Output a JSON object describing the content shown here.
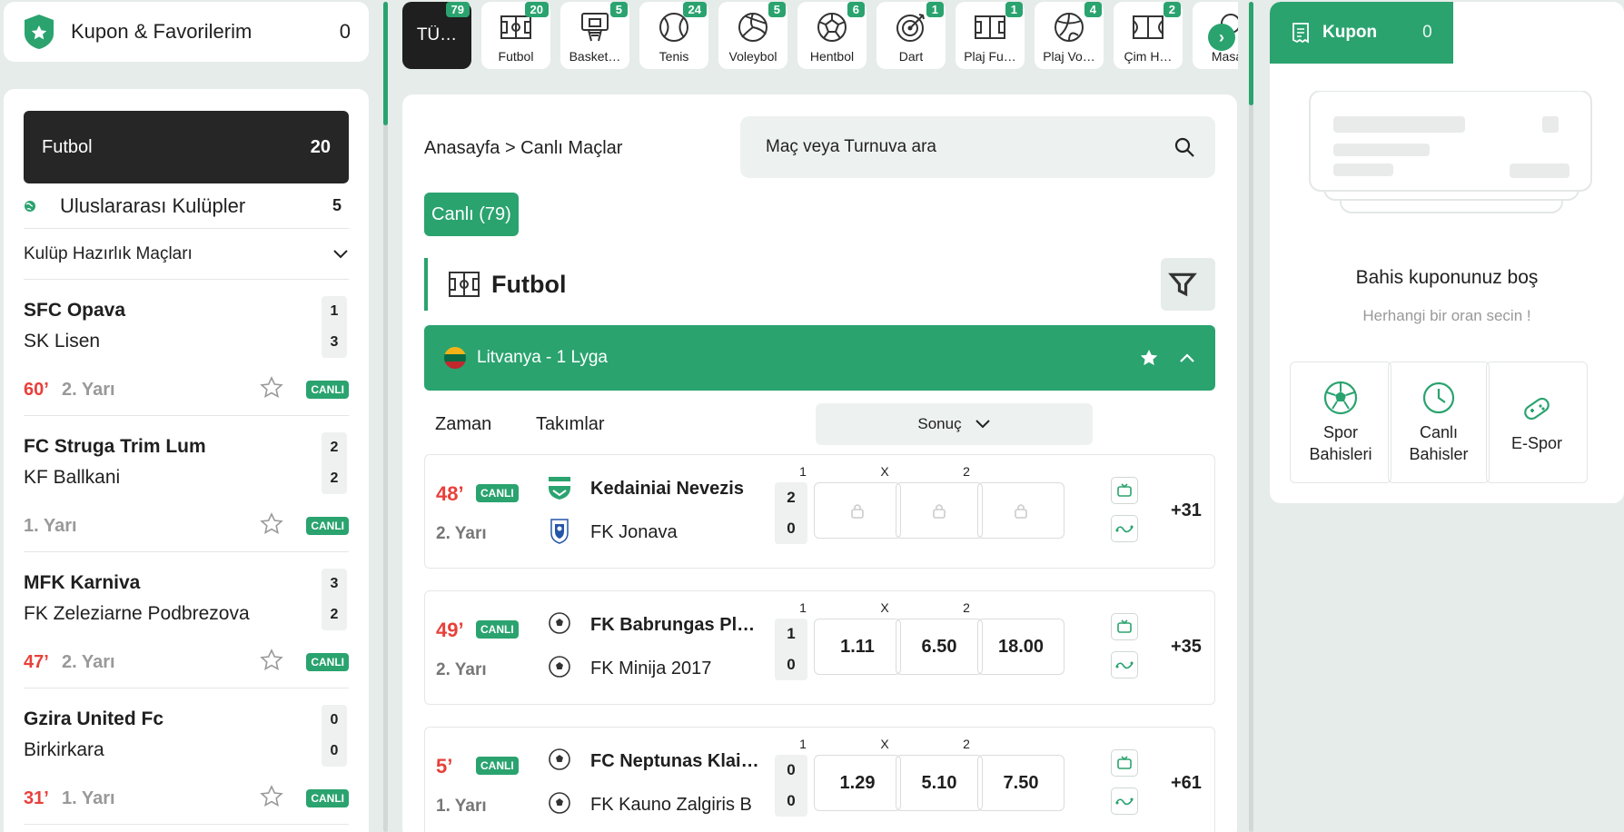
{
  "favorites": {
    "label": "Kupon & Favorilerim",
    "count": "0"
  },
  "left": {
    "sport": {
      "label": "Futbol",
      "count": "20"
    },
    "intl": {
      "label": "Uluslararası Kulüpler",
      "count": "5"
    },
    "category": {
      "label": "Kulüp Hazırlık Maçları"
    },
    "matches": [
      {
        "home": "SFC Opava",
        "away": "SK Lisen",
        "home_score": "1",
        "away_score": "3",
        "minute": "60’",
        "period": "2. Yarı",
        "badge": "CANLI"
      },
      {
        "home": "FC Struga Trim Lum",
        "away": "KF Ballkani",
        "home_score": "2",
        "away_score": "2",
        "minute": "",
        "period": "1. Yarı",
        "badge": "CANLI"
      },
      {
        "home": "MFK Karniva",
        "away": "FK Zeleziarne Podbrezova",
        "home_score": "3",
        "away_score": "2",
        "minute": "47’",
        "period": "2. Yarı",
        "badge": "CANLI"
      },
      {
        "home": "Gzira United Fc",
        "away": "Birkirkara",
        "home_score": "0",
        "away_score": "0",
        "minute": "31’",
        "period": "1. Yarı",
        "badge": "CANLI"
      }
    ]
  },
  "tabs": [
    {
      "label": "TÜ…",
      "count": "79",
      "icon": "all"
    },
    {
      "label": "Futbol",
      "count": "20",
      "icon": "football-field-icon"
    },
    {
      "label": "Basket…",
      "count": "5",
      "icon": "basketball-hoop-icon"
    },
    {
      "label": "Tenis",
      "count": "24",
      "icon": "tennis-ball-icon"
    },
    {
      "label": "Voleybol",
      "count": "5",
      "icon": "volleyball-icon"
    },
    {
      "label": "Hentbol",
      "count": "6",
      "icon": "handball-icon"
    },
    {
      "label": "Dart",
      "count": "1",
      "icon": "dart-target-icon"
    },
    {
      "label": "Plaj Fu…",
      "count": "1",
      "icon": "beach-football-icon"
    },
    {
      "label": "Plaj Vo…",
      "count": "4",
      "icon": "beach-volleyball-icon"
    },
    {
      "label": "Çim H…",
      "count": "2",
      "icon": "field-hockey-icon"
    },
    {
      "label": "Masa",
      "count": "",
      "icon": "table-tennis-icon"
    }
  ],
  "main": {
    "breadcrumb": "Anasayfa > Canlı Maçlar",
    "search_placeholder": "Maç veya Turnuva ara",
    "live_button": "Canlı (79)",
    "section_title": "Futbol",
    "league": "Litvanya - 1 Lyga",
    "col_time": "Zaman",
    "col_teams": "Takımlar",
    "market_select": "Sonuç",
    "odd_labels": [
      "1",
      "X",
      "2"
    ],
    "matches": [
      {
        "minute": "48’",
        "badge": "CANLI",
        "period": "2. Yarı",
        "home": "Kedainiai Nevezis",
        "away": "FK Jonava",
        "home_score": "2",
        "away_score": "0",
        "odds": [
          "",
          "",
          ""
        ],
        "locked": true,
        "more": "+31"
      },
      {
        "minute": "49’",
        "badge": "CANLI",
        "period": "2. Yarı",
        "home": "FK Babrungas Pl…",
        "away": "FK Minija 2017",
        "home_score": "1",
        "away_score": "0",
        "odds": [
          "1.11",
          "6.50",
          "18.00"
        ],
        "locked": false,
        "more": "+35"
      },
      {
        "minute": "5’",
        "badge": "CANLI",
        "period": "1. Yarı",
        "home": "FC Neptunas Klai…",
        "away": "FK Kauno Zalgiris B",
        "home_score": "0",
        "away_score": "0",
        "odds": [
          "1.29",
          "5.10",
          "7.50"
        ],
        "locked": false,
        "more": "+61"
      }
    ]
  },
  "coupon": {
    "tab_label": "Kupon",
    "count": "0",
    "empty_title": "Bahis kuponunuz boş",
    "empty_sub": "Herhangi bir oran secin !",
    "links": [
      "Spor Bahisleri",
      "Canlı Bahisler",
      "E-Spor"
    ]
  },
  "colors": {
    "accent": "#2aa36f",
    "live": "#e8403a",
    "dark": "#262626"
  }
}
